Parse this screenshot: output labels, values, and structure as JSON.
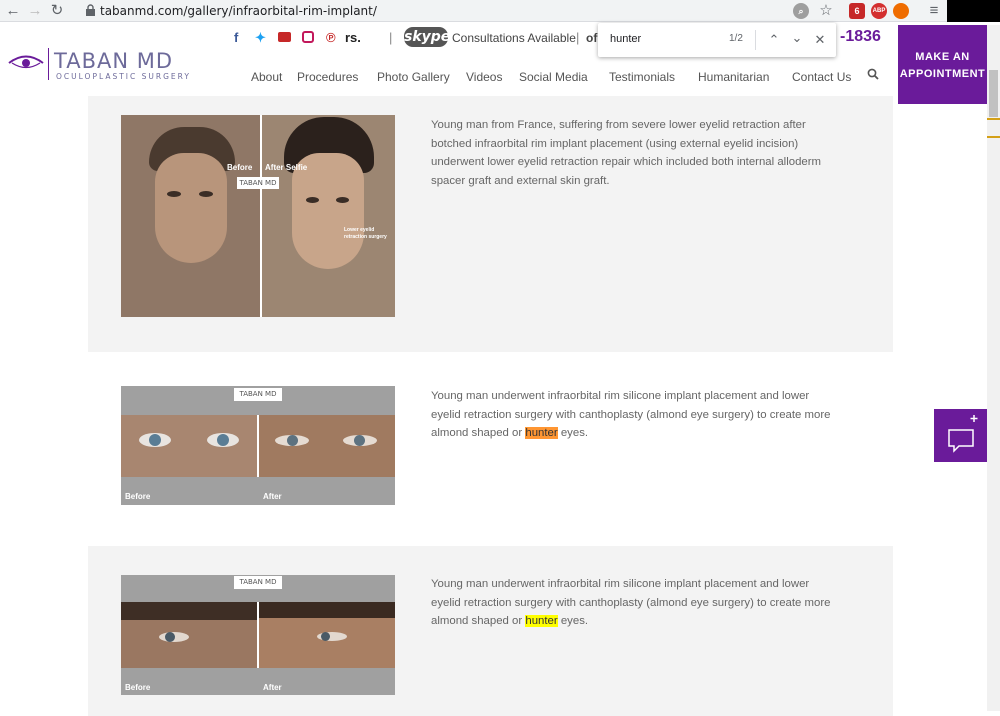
{
  "browser": {
    "url": "tabanmd.com/gallery/infraorbital-rim-implant/",
    "extensions": [
      {
        "name": "ublock-icon",
        "color": "#c62828",
        "label": "6"
      },
      {
        "name": "adblock-icon",
        "color": "#d32f2f",
        "label": "ABP"
      },
      {
        "name": "lastpass-icon",
        "color": "#ef6c00",
        "label": ""
      }
    ]
  },
  "find": {
    "query": "hunter",
    "count": "1/2"
  },
  "header": {
    "logo_title": "TABAN MD",
    "logo_subtitle": "OCULOPLASTIC SURGERY",
    "social_icons": [
      "facebook-icon",
      "twitter-icon",
      "youtube-icon",
      "instagram-icon",
      "pinterest-icon",
      "realself-icon"
    ],
    "realself_label": "rs.",
    "skype_label": "skype",
    "consultations": "Consultations Available",
    "of_text": "of",
    "phone_tail": "-1836",
    "appointment_label": "MAKE AN APPOINTMENT",
    "brand_color": "#6a1b9a"
  },
  "nav": {
    "items": [
      "About",
      "Procedures",
      "Photo Gallery",
      "Videos",
      "Social Media",
      "Testimonials",
      "Humanitarian",
      "Contact Us"
    ]
  },
  "gallery": [
    {
      "before_label": "Before",
      "after_label": "After Selfie",
      "logo_label": "TABAN MD",
      "annotation": "Lower eyelid retraction surgery",
      "text": "Young man from France, suffering from severe lower eyelid retraction after botched infraorbital rim implant placement (using external eyelid incision) underwent lower eyelid retraction repair which included both internal alloderm spacer graft and external skin graft."
    },
    {
      "before_label": "Before",
      "after_label": "After",
      "logo_label": "TABAN MD",
      "text_before": "Young man underwent infraorbital rim silicone implant placement and lower eyelid retraction surgery with canthoplasty (almond eye surgery) to create more almond shaped or ",
      "highlight": "hunter",
      "text_after": " eyes."
    },
    {
      "before_label": "Before",
      "after_label": "After",
      "logo_label": "TABAN MD",
      "text_before": "Young man underwent infraorbital rim silicone implant placement and lower eyelid retraction surgery with canthoplasty (almond eye surgery) to create more almond shaped or ",
      "highlight": "hunter",
      "text_after": " eyes."
    }
  ]
}
